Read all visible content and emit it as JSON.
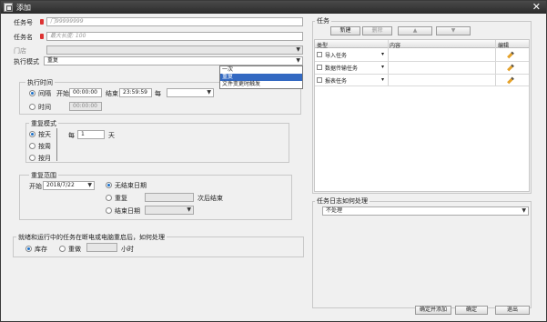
{
  "window": {
    "title": "添加",
    "close_glyph": "✕"
  },
  "form": {
    "task_no_label": "任务号",
    "task_no_placeholder": "门99999999",
    "task_name_label": "任务名",
    "task_name_placeholder": "最大长度: 100",
    "store_label": "门店",
    "exec_mode_label": "执行模式",
    "exec_mode_value": "重复",
    "exec_mode_options": [
      "一次",
      "重复",
      "文件变更时触发"
    ]
  },
  "exec_time": {
    "title": "执行时间",
    "interval_label": "间隔",
    "start_label": "开始",
    "start_value": "00:00:00",
    "end_label": "结束",
    "end_value": "23:59:59",
    "every_label": "每",
    "time_label": "时间",
    "time_value": "00:00:00"
  },
  "repeat_mode": {
    "title": "重复模式",
    "by_day": "按天",
    "by_week": "按周",
    "by_month": "按月",
    "every_label": "每",
    "every_value": "1",
    "unit": "天"
  },
  "repeat_range": {
    "title": "重复范围",
    "start_label": "开始",
    "start_value": "2018/7/22",
    "no_end": "无结束日期",
    "repeat": "重复",
    "after_label": "次后结束",
    "end_date": "结束日期"
  },
  "restart": {
    "title": "就绪和运行中的任务在断电或电脑重启后，如何处理",
    "keep": "库存",
    "redo": "重做",
    "hours": "小时"
  },
  "tasks": {
    "title": "任务",
    "toolbar": {
      "new": "新建",
      "delete": "删除",
      "up": "▲",
      "down": "▼"
    },
    "columns": [
      "类型",
      "内容",
      "编辑"
    ],
    "rows": [
      {
        "type": "导入任务"
      },
      {
        "type": "数据传输任务"
      },
      {
        "type": "报表任务"
      }
    ]
  },
  "log": {
    "title": "任务日志如何处理",
    "value": "不处理"
  },
  "footer": {
    "add_confirm": "确定并添加",
    "ok": "确定",
    "exit": "退出"
  },
  "colors": {
    "selected": "#3369c2",
    "required": "#d33333",
    "edit_icon": "#e5a22a"
  }
}
